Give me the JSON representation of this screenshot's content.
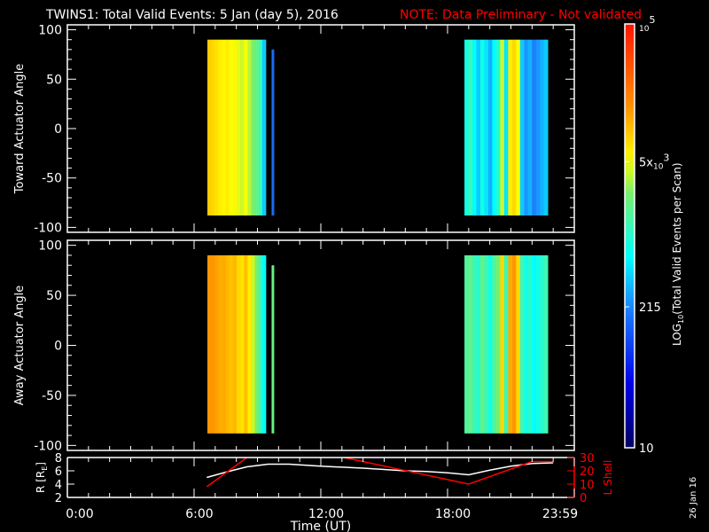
{
  "title": {
    "main": "TWINS1: Total Valid Events:  5 Jan (day   5), 2016",
    "note": "NOTE: Data Preliminary - Not validated",
    "note_color": "#ff0000"
  },
  "side_date": "26 Jan 16",
  "chart_data": [
    {
      "type": "heatmap",
      "name": "toward",
      "ylabel": "Toward Actuator Angle",
      "ylim": [
        -105,
        105
      ],
      "yticks": [
        "100",
        "50",
        "0",
        "-50",
        "-100"
      ],
      "ytick_values": [
        100,
        50,
        0,
        -50,
        -100
      ],
      "angle_range": [
        -88,
        90
      ],
      "blocks": [
        {
          "t_start": 6.63,
          "t_end": 9.4,
          "log_values": [
            3.95,
            3.9,
            3.85,
            3.8,
            3.75,
            3.8,
            3.7,
            3.75,
            3.65,
            3.6,
            3.7,
            3.55,
            3.4,
            3.3,
            3.1,
            2.6
          ]
        },
        {
          "t_start": 9.67,
          "t_end": 9.78,
          "log_values": [
            2.2
          ],
          "angle_range": [
            -88,
            80
          ]
        },
        {
          "t_start": 18.8,
          "t_end": 22.75,
          "log_values": [
            2.9,
            3.1,
            2.8,
            2.6,
            2.9,
            2.7,
            2.5,
            2.8,
            3.0,
            3.6,
            2.7,
            3.8,
            3.9,
            3.7,
            2.6,
            2.4,
            2.5,
            2.3,
            2.4,
            2.5,
            2.6
          ]
        }
      ]
    },
    {
      "type": "heatmap",
      "name": "away",
      "ylabel": "Away Actuator Angle",
      "ylim": [
        -105,
        105
      ],
      "yticks": [
        "100",
        "50",
        "0",
        "-50",
        "-100"
      ],
      "ytick_values": [
        100,
        50,
        0,
        -50,
        -100
      ],
      "angle_range": [
        -88,
        90
      ],
      "blocks": [
        {
          "t_start": 6.63,
          "t_end": 9.4,
          "log_values": [
            4.2,
            4.2,
            4.15,
            4.1,
            4.1,
            4.05,
            4.0,
            4.05,
            3.9,
            3.85,
            4.0,
            3.8,
            3.6,
            3.4,
            3.1,
            2.8
          ]
        },
        {
          "t_start": 9.67,
          "t_end": 9.78,
          "log_values": [
            3.3
          ],
          "angle_range": [
            -88,
            80
          ]
        },
        {
          "t_start": 18.8,
          "t_end": 22.75,
          "log_values": [
            3.2,
            3.3,
            3.1,
            3.0,
            3.3,
            3.1,
            2.9,
            3.2,
            3.4,
            3.9,
            3.1,
            4.1,
            4.2,
            3.9,
            3.1,
            2.9,
            3.0,
            2.8,
            2.9,
            3.0,
            3.1
          ]
        }
      ]
    },
    {
      "type": "line",
      "name": "orbit",
      "ylabel": "R [R",
      "ylabel_sub": "E",
      "ylabel_close": "]",
      "ylim": [
        2,
        8
      ],
      "yticks": [
        "8",
        "6",
        "4",
        "2"
      ],
      "ytick_values": [
        8,
        6,
        4,
        2
      ],
      "y2label": "L Shell",
      "y2lim": [
        0,
        30
      ],
      "y2ticks": [
        "30",
        "20",
        "10",
        "0"
      ],
      "y2tick_values": [
        30,
        20,
        10,
        0
      ],
      "xlabel": "Time (UT)",
      "xlim": [
        0,
        24
      ],
      "xticks": [
        "0:00",
        "6:00",
        "12:00",
        "18:00",
        "23:59"
      ],
      "xtick_values": [
        0,
        6,
        12,
        18,
        24
      ],
      "series": [
        {
          "name": "R",
          "color": "#ffffff",
          "x": [
            6.6,
            7.5,
            8.5,
            9.5,
            10.5,
            12,
            14,
            16,
            17,
            18,
            19,
            20,
            21,
            22,
            23
          ],
          "y": [
            5.0,
            5.8,
            6.6,
            7.0,
            7.0,
            6.7,
            6.4,
            6.0,
            5.9,
            5.7,
            5.4,
            6.1,
            6.7,
            7.1,
            7.2
          ]
        },
        {
          "name": "L Shell",
          "color": "#ff0000",
          "segments": [
            {
              "x": [
                6.6,
                8.5
              ],
              "y": [
                8,
                30
              ]
            },
            {
              "x": [
                13.1,
                19,
                22,
                23
              ],
              "y": [
                30,
                10,
                27,
                27
              ]
            }
          ]
        }
      ]
    }
  ],
  "colorbar": {
    "label_prefix": "LOG",
    "label_sub": "10",
    "label_rest": "(Total Valid Events per Scan)",
    "log_range": [
      1,
      5
    ],
    "ticks": [
      {
        "label": "10",
        "log": 1
      },
      {
        "label": "215",
        "log": 2.33
      },
      {
        "label": "5x",
        "sub": "10",
        "sup": "3",
        "log": 3.7
      },
      {
        "label": "",
        "sub": "10",
        "sup": "5",
        "log": 5
      }
    ]
  }
}
